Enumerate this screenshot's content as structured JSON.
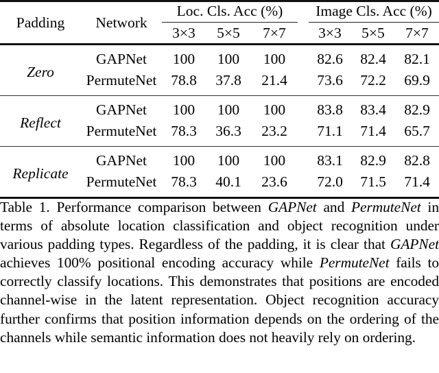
{
  "table": {
    "headers": {
      "padding": "Padding",
      "network": "Network",
      "groups": [
        {
          "title": "Loc. Cls. Acc (%)",
          "subcolumns": [
            "3×3",
            "5×5",
            "7×7"
          ]
        },
        {
          "title": "Image Cls. Acc (%)",
          "subcolumns": [
            "3×3",
            "5×5",
            "7×7"
          ]
        }
      ]
    },
    "groups": [
      {
        "padding": "Zero",
        "rows": [
          {
            "network": "GAPNet",
            "loc": [
              "100",
              "100",
              "100"
            ],
            "img": [
              "82.6",
              "82.4",
              "82.1"
            ]
          },
          {
            "network": "PermuteNet",
            "loc": [
              "78.8",
              "37.8",
              "21.4"
            ],
            "img": [
              "73.6",
              "72.2",
              "69.9"
            ]
          }
        ]
      },
      {
        "padding": "Reflect",
        "rows": [
          {
            "network": "GAPNet",
            "loc": [
              "100",
              "100",
              "100"
            ],
            "img": [
              "83.8",
              "83.4",
              "82.9"
            ]
          },
          {
            "network": "PermuteNet",
            "loc": [
              "78.3",
              "36.3",
              "23.2"
            ],
            "img": [
              "71.1",
              "71.4",
              "65.7"
            ]
          }
        ]
      },
      {
        "padding": "Replicate",
        "rows": [
          {
            "network": "GAPNet",
            "loc": [
              "100",
              "100",
              "100"
            ],
            "img": [
              "83.1",
              "82.9",
              "82.8"
            ]
          },
          {
            "network": "PermuteNet",
            "loc": [
              "78.3",
              "40.1",
              "23.6"
            ],
            "img": [
              "72.0",
              "71.5",
              "71.4"
            ]
          }
        ]
      }
    ]
  },
  "caption": {
    "label": "Table 1.",
    "segments": [
      {
        "text": " Performance comparison between ",
        "italic": false
      },
      {
        "text": "GAPNet",
        "italic": true
      },
      {
        "text": " and ",
        "italic": false
      },
      {
        "text": "PermuteNet",
        "italic": true
      },
      {
        "text": " in terms of absolute location classification and object recognition under various padding types. Regardless of the padding, it is clear that ",
        "italic": false
      },
      {
        "text": "GAPNet",
        "italic": true
      },
      {
        "text": " achieves 100% positional encoding accuracy while ",
        "italic": false
      },
      {
        "text": "PermuteNet",
        "italic": true
      },
      {
        "text": " fails to correctly classify locations. This demonstrates that positions are encoded channel-wise in the latent representation. Object recognition accuracy further confirms that position information depends on the ordering of the channels while semantic information does not heavily rely on ordering.",
        "italic": false
      }
    ],
    "full_text": "Table 1. Performance comparison between GAPNet and PermuteNet in terms of absolute location classification and object recognition under various padding types. Regardless of the padding, it is clear that GAPNet achieves 100% positional encoding accuracy while PermuteNet fails to correctly classify locations. This demonstrates that positions are encoded channel-wise in the latent representation. Object recognition accuracy further confirms that position information depends on the ordering of the channels while semantic information does not heavily rely on ordering."
  },
  "colors": {
    "background": "#ffffff",
    "text": "#000000",
    "rule": "#111111"
  }
}
